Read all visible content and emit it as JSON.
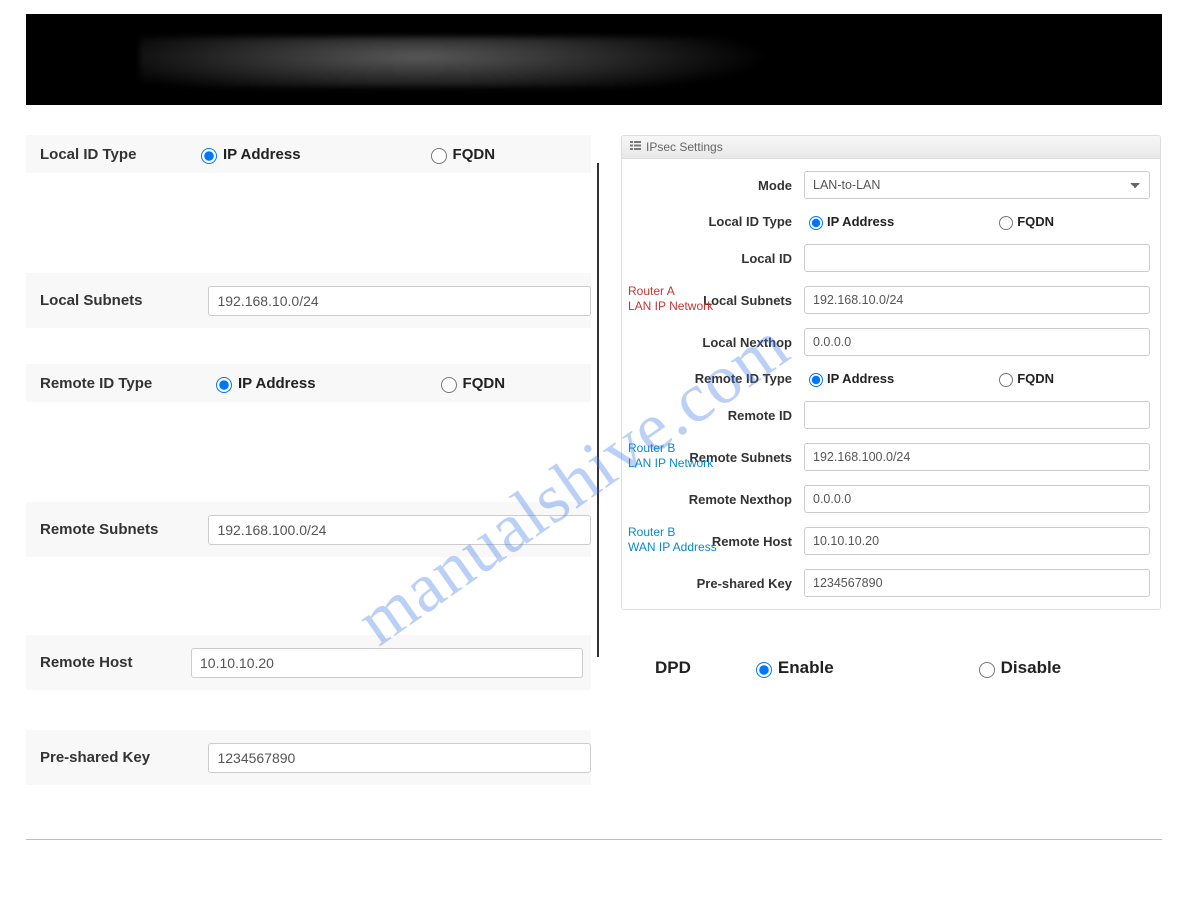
{
  "watermark": "manualshive.com",
  "left": {
    "localIdType": {
      "label": "Local ID Type",
      "ipaddr": "IP Address",
      "fqdn": "FQDN"
    },
    "localSubnets": {
      "label": "Local Subnets",
      "value": "192.168.10.0/24"
    },
    "remoteIdType": {
      "label": "Remote ID Type",
      "ipaddr": "IP Address",
      "fqdn": "FQDN"
    },
    "remoteSubnets": {
      "label": "Remote Subnets",
      "value": "192.168.100.0/24"
    },
    "remoteHost": {
      "label": "Remote Host",
      "value": "10.10.10.20"
    },
    "presharedKey": {
      "label": "Pre-shared Key",
      "value": "1234567890"
    }
  },
  "right": {
    "panelTitle": "IPsec Settings",
    "mode": {
      "label": "Mode",
      "value": "LAN-to-LAN"
    },
    "localIdType": {
      "label": "Local ID Type",
      "ipaddr": "IP Address",
      "fqdn": "FQDN"
    },
    "localId": {
      "label": "Local ID",
      "value": ""
    },
    "localSubnets": {
      "label": "Local Subnets",
      "value": "192.168.10.0/24",
      "ann1": "Router A",
      "ann2": "LAN IP Network"
    },
    "localNexthop": {
      "label": "Local Nexthop",
      "value": "0.0.0.0"
    },
    "remoteIdType": {
      "label": "Remote ID Type",
      "ipaddr": "IP Address",
      "fqdn": "FQDN"
    },
    "remoteId": {
      "label": "Remote ID",
      "value": ""
    },
    "remoteSubnets": {
      "label": "Remote Subnets",
      "value": "192.168.100.0/24",
      "ann1": "Router B",
      "ann2": "LAN IP Network"
    },
    "remoteNexthop": {
      "label": "Remote Nexthop",
      "value": "0.0.0.0"
    },
    "remoteHost": {
      "label": "Remote Host",
      "value": "10.10.10.20",
      "ann1": "Router B",
      "ann2": "WAN IP Address"
    },
    "presharedKey": {
      "label": "Pre-shared Key",
      "value": "1234567890"
    }
  },
  "dpd": {
    "label": "DPD",
    "enable": "Enable",
    "disable": "Disable"
  }
}
